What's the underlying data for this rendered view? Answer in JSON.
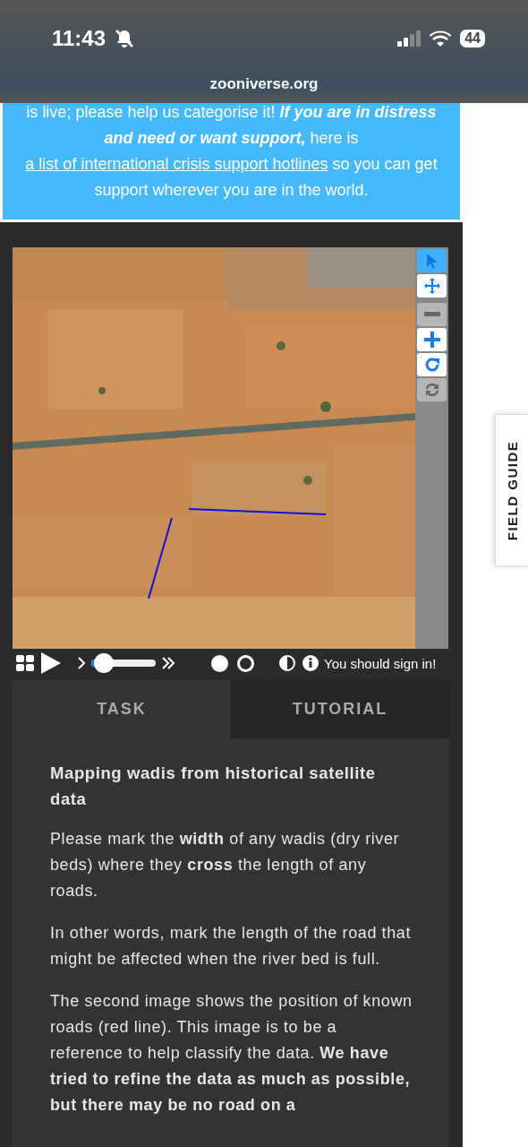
{
  "status_bar": {
    "time": "11:43",
    "battery": "44"
  },
  "browser": {
    "url": "zooniverse.org"
  },
  "banner": {
    "lead": "is live; please help us categorise it!",
    "emphasis": "If you are in distress and need or want support,",
    "middle": "here is",
    "link": "a list of international crisis support hotlines",
    "tail": "so you can get support wherever you are in the world."
  },
  "viewer": {
    "tools": [
      {
        "kind": "pointer",
        "selected": true,
        "disabled": false
      },
      {
        "kind": "move",
        "selected": false,
        "disabled": false
      },
      {
        "kind": "zoom-out",
        "selected": false,
        "disabled": true
      },
      {
        "kind": "zoom-in",
        "selected": false,
        "disabled": false
      },
      {
        "kind": "rotate",
        "selected": false,
        "disabled": false
      },
      {
        "kind": "reset",
        "selected": false,
        "disabled": true
      }
    ],
    "speed": {
      "level": 0.2
    },
    "frames": [
      {
        "selected": true
      },
      {
        "selected": false
      }
    ],
    "notice": "You should sign in!"
  },
  "tabs": [
    {
      "label": "TASK",
      "selected": true
    },
    {
      "label": "TUTORIAL",
      "selected": false
    }
  ],
  "task": {
    "title": "Mapping wadis from historical satellite data",
    "paragraphs": [
      "Please mark the **width** of any wadis (dry river beds) where they **cross** the length of any roads.",
      "In other words, mark the length of the road that might be affected when the river bed is full.",
      "The second image shows the position of known roads (red line). This image is to be a reference to help classify the data. **We have tried to refine the data as much as possible, but there may be no road on a**"
    ]
  },
  "field_guide": {
    "label": "FIELD GUIDE"
  }
}
